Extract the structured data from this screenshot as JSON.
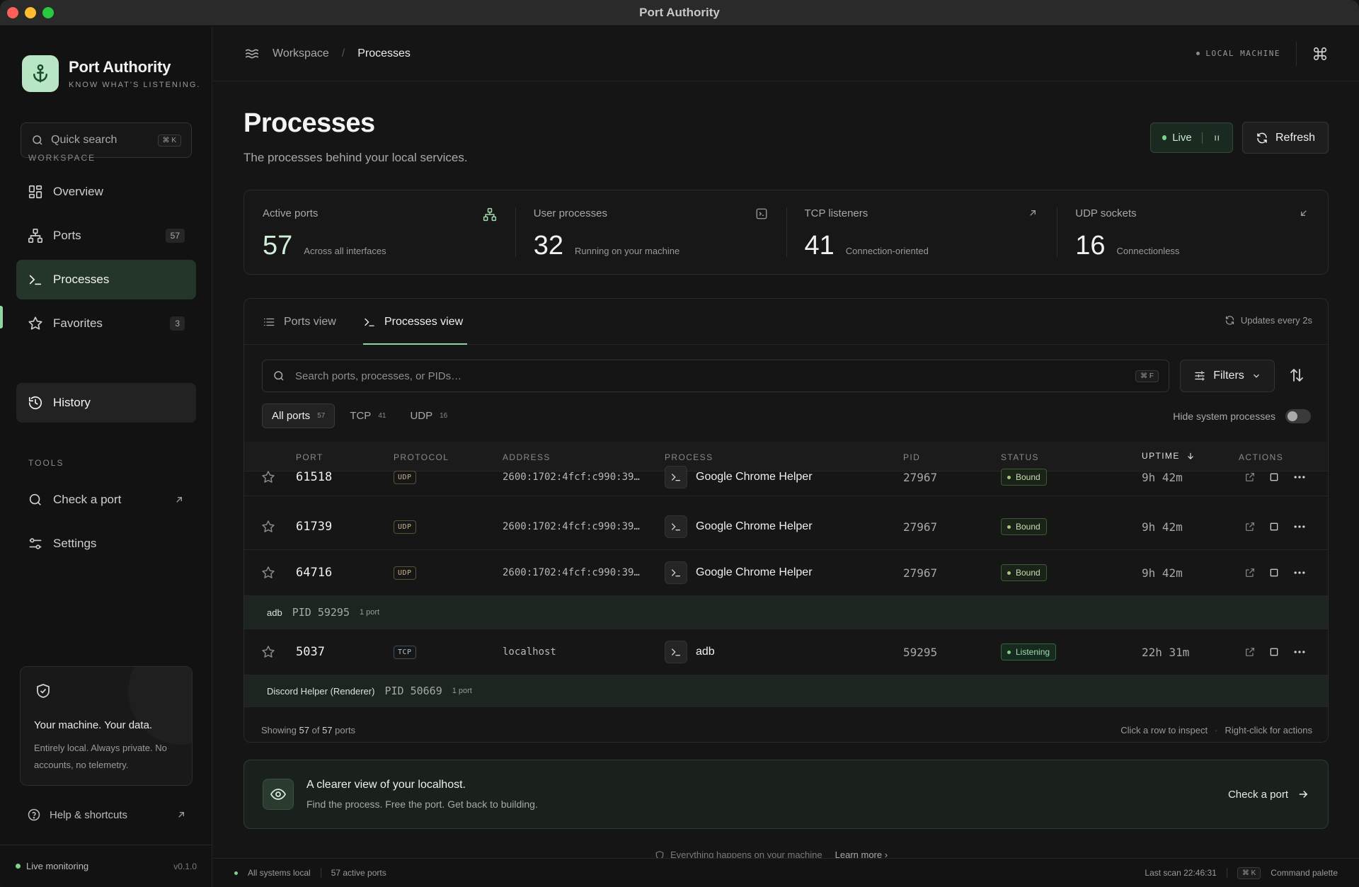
{
  "window": {
    "title": "Port Authority"
  },
  "brand": {
    "name": "Port Authority",
    "tagline": "KNOW WHAT'S LISTENING."
  },
  "quick_search": {
    "label": "Quick search",
    "shortcut": "⌘ K"
  },
  "sidebar": {
    "workspace_label": "WORKSPACE",
    "tools_label": "TOOLS",
    "items": [
      {
        "label": "Overview",
        "icon": "grid-icon"
      },
      {
        "label": "Ports",
        "icon": "network-icon",
        "count": "57"
      },
      {
        "label": "Processes",
        "icon": "terminal-icon"
      },
      {
        "label": "Favorites",
        "icon": "star-icon",
        "count": "3"
      },
      {
        "label": "History",
        "icon": "history-icon"
      }
    ],
    "tools": [
      {
        "label": "Check a port",
        "icon": "search-icon"
      },
      {
        "label": "Settings",
        "icon": "sliders-icon"
      }
    ],
    "privacy": {
      "title": "Your machine. Your data.",
      "text": "Entirely local. Always private. No accounts, no telemetry."
    },
    "help": "Help & shortcuts",
    "footer": {
      "status": "Live monitoring",
      "version": "v0.1.0"
    }
  },
  "topbar": {
    "breadcrumb_root": "Workspace",
    "breadcrumb_current": "Processes",
    "machine": "LOCAL MACHINE"
  },
  "page": {
    "title": "Processes",
    "subtitle": "The processes behind your local services.",
    "live_label": "Live",
    "refresh_label": "Refresh"
  },
  "stats": [
    {
      "label": "Active ports",
      "value": "57",
      "desc": "Across all interfaces"
    },
    {
      "label": "User processes",
      "value": "32",
      "desc": "Running on your machine"
    },
    {
      "label": "TCP listeners",
      "value": "41",
      "desc": "Connection-oriented"
    },
    {
      "label": "UDP sockets",
      "value": "16",
      "desc": "Connectionless"
    }
  ],
  "panel": {
    "tabs": [
      "Ports view",
      "Processes view"
    ],
    "updates": "Updates every 2s",
    "search_placeholder": "Search ports, processes, or PIDs…",
    "search_shortcut": "⌘ F",
    "filters_label": "Filters",
    "chips": [
      {
        "label": "All ports",
        "count": "57"
      },
      {
        "label": "TCP",
        "count": "41"
      },
      {
        "label": "UDP",
        "count": "16"
      }
    ],
    "hide_system": "Hide system processes",
    "columns": [
      "PORT",
      "PROTOCOL",
      "ADDRESS",
      "PROCESS",
      "PID",
      "STATUS",
      "UPTIME",
      "ACTIONS"
    ],
    "rows": [
      {
        "port": "61518",
        "protocol": "UDP",
        "address": "2600:1702:4fcf:c990:39…",
        "process": "Google Chrome Helper",
        "pid": "27967",
        "status": "Bound",
        "uptime": "9h 42m"
      },
      {
        "port": "61739",
        "protocol": "UDP",
        "address": "2600:1702:4fcf:c990:39…",
        "process": "Google Chrome Helper",
        "pid": "27967",
        "status": "Bound",
        "uptime": "9h 42m"
      },
      {
        "port": "64716",
        "protocol": "UDP",
        "address": "2600:1702:4fcf:c990:39…",
        "process": "Google Chrome Helper",
        "pid": "27967",
        "status": "Bound",
        "uptime": "9h 42m"
      }
    ],
    "group_adb": {
      "name": "adb",
      "pid": "PID 59295",
      "count": "1 port"
    },
    "row_adb": {
      "port": "5037",
      "protocol": "TCP",
      "address": "localhost",
      "process": "adb",
      "pid": "59295",
      "status": "Listening",
      "uptime": "22h 31m"
    },
    "group_discord": {
      "name": "Discord Helper (Renderer)",
      "pid": "PID 50669",
      "count": "1 port"
    },
    "footer": {
      "showing": "Showing",
      "shown": "57",
      "of": "of",
      "total": "57",
      "suffix": "ports",
      "hint1": "Click a row to inspect",
      "hint2": "Right-click for actions"
    }
  },
  "banner": {
    "title": "A clearer view of your localhost.",
    "subtitle": "Find the process. Free the port. Get back to building.",
    "cta": "Check a port"
  },
  "faded_note": {
    "text": "Everything happens on your machine",
    "link": "Learn more"
  },
  "statusbar": {
    "left1": "All systems local",
    "left2": "57 active ports",
    "last_scan": "Last scan 22:46:31",
    "shortcut": "⌘ K",
    "palette": "Command palette"
  },
  "colors": {
    "accent": "#8fd6a3",
    "active_nav": "#24352a",
    "live_dot": "#7ed28f"
  }
}
